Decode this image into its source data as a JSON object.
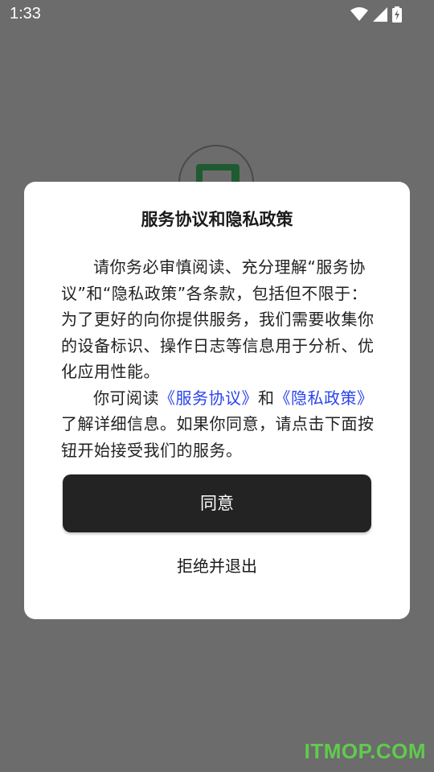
{
  "status_bar": {
    "time": "1:33",
    "icons": [
      "wifi-icon",
      "cell-signal-icon",
      "battery-charging-icon"
    ]
  },
  "dialog": {
    "title": "服务协议和隐私政策",
    "paragraph1": "请你务必审慎阅读、充分理解“服务协议”和“隐私政策”各条款，包括但不限于：为了更好的向你提供服务，我们需要收集你的设备标识、操作日志等信息用于分析、优化应用性能。",
    "paragraph2_prefix": "你可阅读",
    "link_service": "《服务协议》",
    "paragraph2_and": "和",
    "link_privacy": "《隐私政策》",
    "paragraph2_suffix": "了解详细信息。如果你同意，请点击下面按钮开始接受我们的服务。",
    "agree_label": "同意",
    "reject_label": "拒绝并退出"
  },
  "watermark": "ITMOP.COM",
  "colors": {
    "scrim": "#6c6c6c",
    "dialog_bg": "#ffffff",
    "button_bg": "#232323",
    "link": "#2a44ee",
    "logo_green": "#1f5a31",
    "watermark": "#5fd64a"
  }
}
